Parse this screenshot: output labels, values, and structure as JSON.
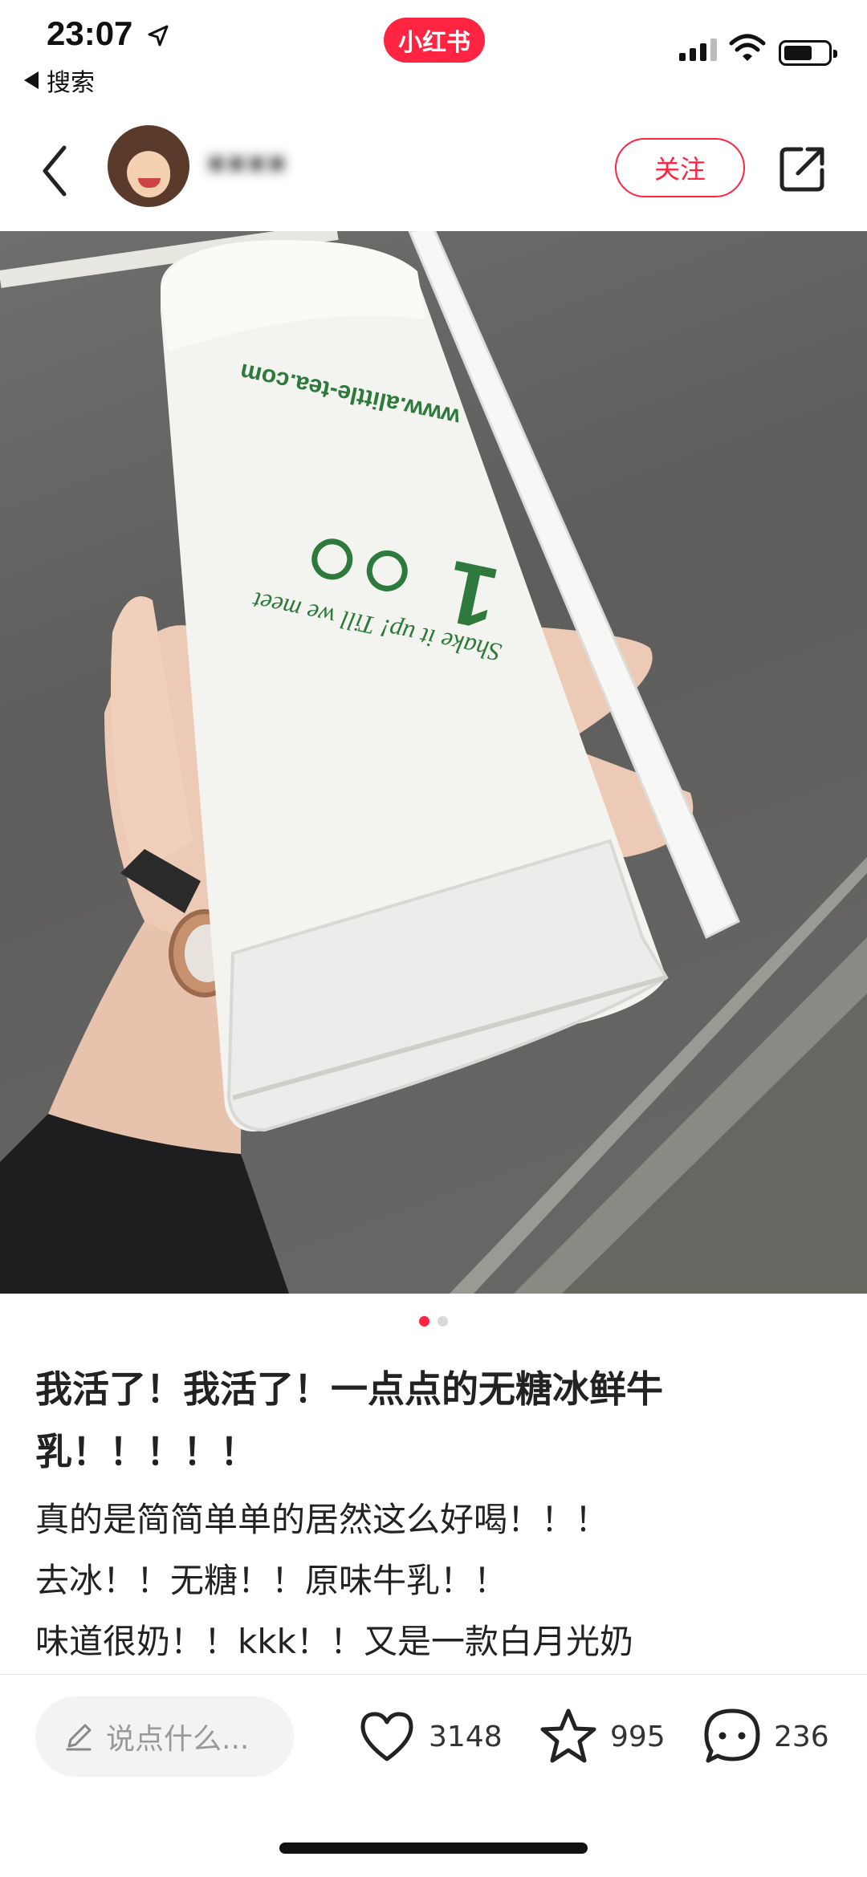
{
  "status_bar": {
    "time": "23:07",
    "back_app_label": "搜索",
    "app_badge": "小红书"
  },
  "header": {
    "username": "▪︎▪︎▪︎▪︎",
    "follow_label": "关注"
  },
  "photo": {
    "cup_url_text": "www.alittle-tea.com",
    "cup_slogan": "Shake it up! Till we meet",
    "cup_brand_number": "1",
    "page_count": 2,
    "current_page": 1
  },
  "post": {
    "title": "我活了！我活了！一点点的无糖冰鲜牛乳！！！！！",
    "body_lines": [
      "真的是简简单单的居然这么好喝！！！",
      "去冰！！无糖！！原味牛乳！！",
      "味道很奶！！kkk！！又是一款白月光奶"
    ]
  },
  "bottom_bar": {
    "comment_placeholder": "说点什么...",
    "likes": "3148",
    "collects": "995",
    "comments": "236"
  },
  "colors": {
    "accent": "#ff2442",
    "text": "#222222",
    "muted": "#999999"
  },
  "icons": [
    "location-arrow-icon",
    "back-triangle-icon",
    "signal-icon",
    "wifi-icon",
    "battery-icon",
    "chevron-left-icon",
    "share-icon",
    "pencil-icon",
    "heart-icon",
    "star-icon",
    "comment-bubble-icon"
  ]
}
